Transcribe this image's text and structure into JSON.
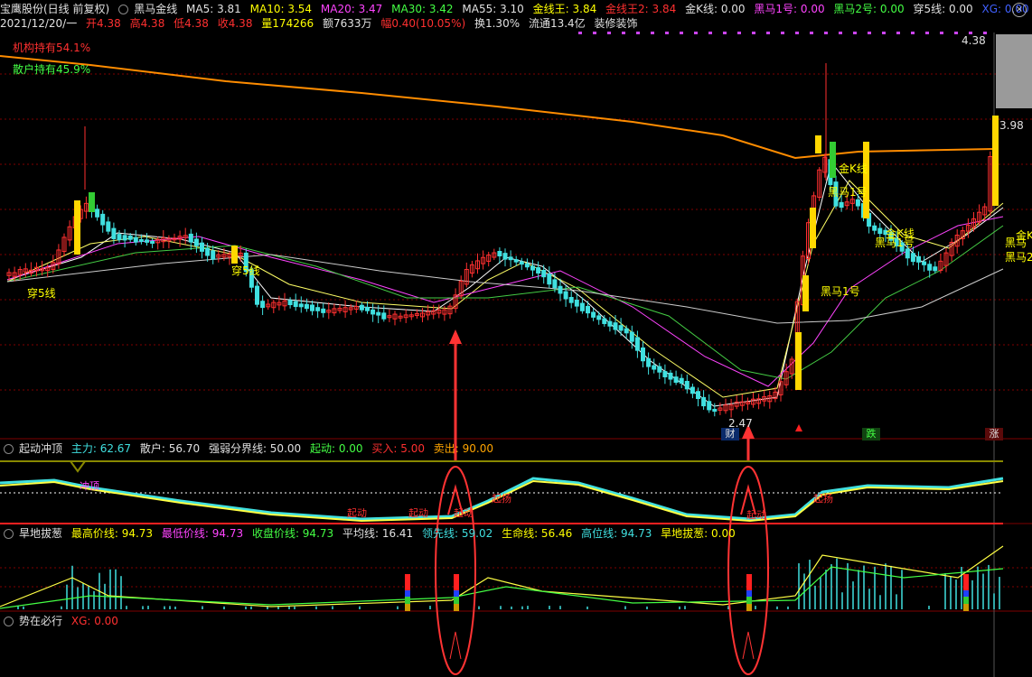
{
  "topbar": {
    "stock_name": "宝鹰股份(日线 前复权)",
    "indicator": "黑马金线",
    "ma5": "MA5: 3.81",
    "ma10": "MA10: 3.54",
    "ma20": "MA20: 3.47",
    "ma30": "MA30: 3.42",
    "ma55": "MA55: 3.10",
    "jxw": "金线王: 3.84",
    "jxw2": "金线王2: 3.84",
    "jk": "金K线: 0.00",
    "hm1": "黑马1号: 0.00",
    "hm2": "黑马2号: 0.00",
    "c5": "穿5线: 0.00",
    "xg": "XG: 0.00"
  },
  "infobar": {
    "date": "2021/12/20/一",
    "open": "开4.38",
    "high": "高4.38",
    "low": "低4.38",
    "close": "收4.38",
    "vol": "量174266",
    "amount": "额7633万",
    "change": "幅0.40(10.05%)",
    "turnover": "换1.30%",
    "float": "流通13.4亿",
    "industry": "装修装饰"
  },
  "main": {
    "inst_hold": "机构持有54.1%",
    "retail_hold": "散户持有45.9%",
    "high_price": "4.38",
    "price_398": "3.98",
    "low_price": "2.47",
    "labels": {
      "chuan5_a": "穿5线",
      "chuan5_b": "穿5线",
      "hm1": "黑马1号",
      "jk1": "金K线",
      "hm_a": "黑马1号",
      "jk2": "金K线",
      "hm_b": "黑马1号",
      "jk3": "金K线",
      "hm_c": "黑马",
      "hm_d": "黑马2"
    },
    "tags": {
      "cai": "财",
      "die": "跌",
      "zhang": "涨"
    }
  },
  "panel1": {
    "title": "起动冲顶",
    "zhuli": "主力: 62.67",
    "sanhu": "散户: 56.70",
    "qiangruo": "强弱分界线: 50.00",
    "qidong": "起动: 0.00",
    "mairu": "买入: 5.00",
    "maichu": "卖出: 90.00",
    "labels": {
      "chongding": "冲顶",
      "qd1": "起动",
      "qd2": "起动",
      "qd3": "起动",
      "qd4": "起动",
      "qy1": "起扬",
      "qy2": "起扬"
    }
  },
  "panel2": {
    "title": "旱地拔葱",
    "zgj": "最高价线: 94.73",
    "zdj": "最低价线: 94.73",
    "spj": "收盘价线: 94.73",
    "pjx": "平均线: 16.41",
    "lxx": "领先线: 59.02",
    "smx": "生命线: 56.46",
    "gwx": "高位线: 94.73",
    "hdbc": "旱地拔葱: 0.00"
  },
  "panel3": {
    "title": "势在必行",
    "xg": "XG: 0.00"
  },
  "colors": {
    "up_candle": "#ff3030",
    "down_candle": "#40e0e0",
    "gold": "#ffd700",
    "green_bar": "#33cc33",
    "ma5": "#ffffff",
    "ma10": "#ffff66",
    "ma20": "#ff44ff",
    "ma30": "#44cc44",
    "ma55": "#cccccc",
    "long_ma": "#ff8c00",
    "grid": "#800000",
    "annotation": "#ff3333"
  }
}
